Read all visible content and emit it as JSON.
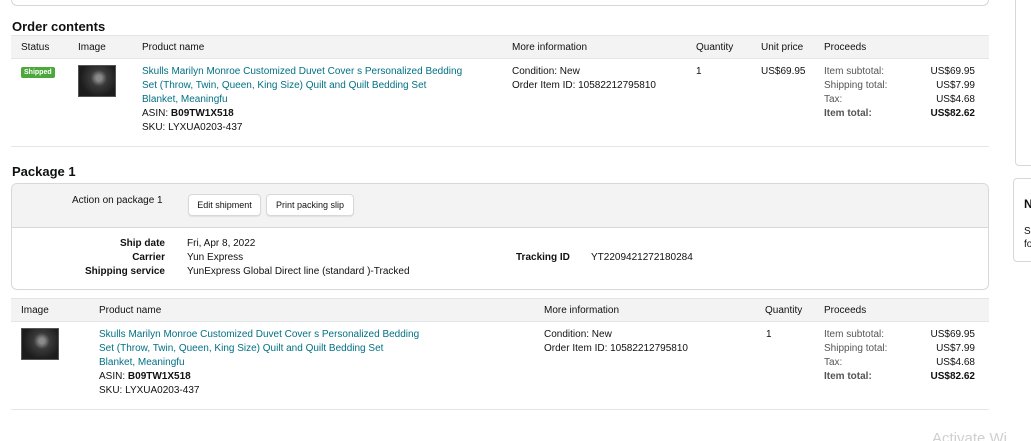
{
  "order_contents": {
    "title": "Order contents",
    "headers": {
      "status": "Status",
      "image": "Image",
      "product": "Product name",
      "more": "More information",
      "qty": "Quantity",
      "unit": "Unit price",
      "proceeds": "Proceeds"
    },
    "item": {
      "status": "Shipped",
      "title_line1": "Skulls Marilyn Monroe Customized Duvet Cover s Personalized Bedding",
      "title_line2": "Set (Throw, Twin, Queen, King Size) Quilt and Quilt Bedding Set",
      "title_line3": "Blanket, Meaningfu",
      "asin_label": "ASIN:",
      "asin": "B09TW1X518",
      "sku_label": "SKU:",
      "sku": "LYXUA0203-437",
      "condition": "Condition: New",
      "order_item_id": "Order Item ID: 10582212795810",
      "quantity": "1",
      "unit_price": "US$69.95",
      "proceeds": {
        "subtotal_label": "Item subtotal:",
        "subtotal": "US$69.95",
        "shipping_label": "Shipping total:",
        "shipping": "US$7.99",
        "tax_label": "Tax:",
        "tax": "US$4.68",
        "total_label": "Item total:",
        "total": "US$82.62"
      }
    }
  },
  "package": {
    "title": "Package 1",
    "action_label": "Action on package 1",
    "edit_button": "Edit shipment",
    "print_button": "Print packing slip",
    "ship_date_label": "Ship date",
    "ship_date": "Fri, Apr 8, 2022",
    "carrier_label": "Carrier",
    "carrier": "Yun Express",
    "service_label": "Shipping service",
    "service": "YunExpress Global Direct line (standard )-Tracked",
    "tracking_label": "Tracking ID",
    "tracking": "YT2209421272180284",
    "headers": {
      "image": "Image",
      "product": "Product name",
      "more": "More information",
      "qty": "Quantity",
      "proceeds": "Proceeds"
    },
    "item": {
      "title_line1": "Skulls Marilyn Monroe Customized Duvet Cover s Personalized Bedding",
      "title_line2": "Set (Throw, Twin, Queen, King Size) Quilt and Quilt Bedding Set",
      "title_line3": "Blanket, Meaningfu",
      "asin_label": "ASIN:",
      "asin": "B09TW1X518",
      "sku_label": "SKU:",
      "sku": "LYXUA0203-437",
      "condition": "Condition: New",
      "order_item_id": "Order Item ID: 10582212795810",
      "quantity": "1",
      "proceeds": {
        "subtotal_label": "Item subtotal:",
        "subtotal": "US$69.95",
        "shipping_label": "Shipping total:",
        "shipping": "US$7.99",
        "tax_label": "Tax:",
        "tax": "US$4.68",
        "total_label": "Item total:",
        "total": "US$82.62"
      }
    }
  },
  "side": {
    "card_head": "N",
    "card_line1": "S",
    "card_line2": "fo"
  },
  "watermark": "Activate Wi",
  "colors": {
    "link": "#007185",
    "badge": "#4ca83b",
    "header_bg": "#f3f3f3",
    "border": "#d5d9d9"
  }
}
